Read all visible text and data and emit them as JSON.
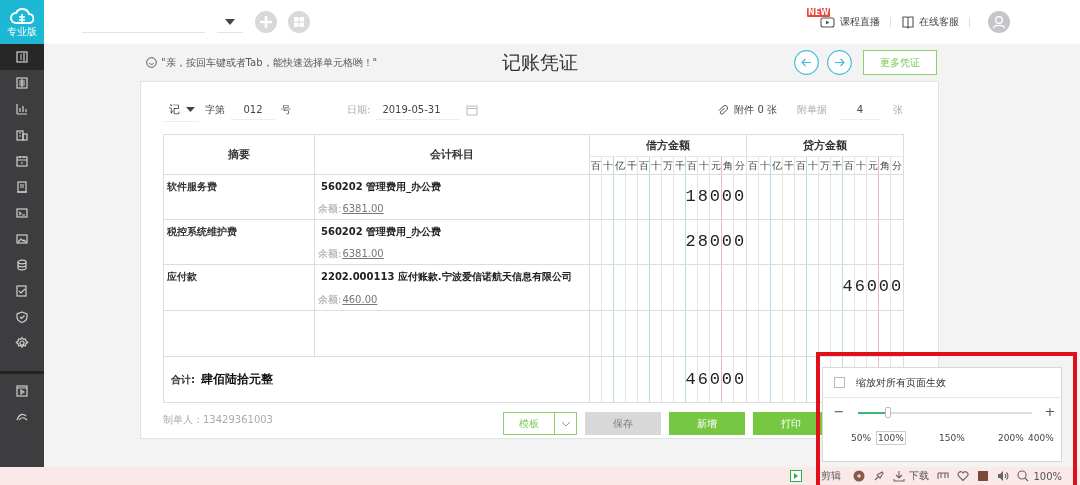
{
  "app": {
    "edition": "专业版"
  },
  "sidebar": {
    "items": [
      {
        "selected": true
      },
      {
        "selected": false
      },
      {
        "selected": false
      },
      {
        "selected": false
      },
      {
        "selected": false
      },
      {
        "selected": false
      },
      {
        "selected": false
      },
      {
        "selected": false
      },
      {
        "selected": false
      },
      {
        "selected": false
      },
      {
        "selected": false
      },
      {
        "selected": false
      }
    ],
    "extra_items": [
      {
        "selected": false
      },
      {
        "selected": false
      }
    ]
  },
  "topbar": {
    "new_badge": "NEW",
    "live_link": "课程直播",
    "service_link": "在线客服"
  },
  "voucher": {
    "tip": "\"亲，按回车键或者Tab，能快速选择单元格哟！\"",
    "title": "记账凭证",
    "more_button": "更多凭证",
    "type": "记",
    "word_label": "字第",
    "number": "012",
    "number_suffix": "号",
    "date_label": "日期:",
    "date": "2019-05-31",
    "attachments": "附件 0 张",
    "docs_label": "附单据",
    "docs_count": "4",
    "docs_suffix": "张",
    "table": {
      "columns": [
        "摘要",
        "会计科目",
        "借方金额",
        "贷方金额"
      ],
      "debit_units": [
        "百",
        "十",
        "亿",
        "千",
        "百",
        "十",
        "万",
        "千",
        "百",
        "十",
        "元",
        "角",
        "分"
      ],
      "credit_units": [
        "百",
        "十",
        "亿",
        "千",
        "百",
        "十",
        "万",
        "千",
        "百",
        "十",
        "元",
        "角",
        "分"
      ],
      "rows": [
        {
          "summary": "软件服务费",
          "account": "560202 管理费用_办公费",
          "balance_label": "余额:",
          "balance": "6381.00",
          "debit": "18000"
        },
        {
          "summary": "税控系统维护费",
          "account": "560202 管理费用_办公费",
          "balance_label": "余额:",
          "balance": "6381.00",
          "debit": "28000"
        },
        {
          "summary": "应付款",
          "account": "2202.000113 应付账款.宁波爱信诺航天信息有限公司",
          "balance_label": "余额:",
          "balance": "460.00",
          "credit": "46000"
        },
        {}
      ],
      "total_label": "合计:",
      "total_words": "肆佰陆拾元整",
      "total_debit": "46000"
    },
    "maker": "制单人：13429361003",
    "buttons": [
      {
        "kind": "split",
        "label": "模板",
        "disabled": false
      },
      {
        "kind": "solid",
        "label": "保存",
        "disabled": true
      },
      {
        "kind": "solid",
        "label": "新增",
        "disabled": false
      },
      {
        "kind": "solid",
        "label": "打印",
        "disabled": false
      }
    ]
  },
  "zoom_popup": {
    "checkbox": {
      "label": "缩放对所有页面生效",
      "checked": false
    },
    "minus": "−",
    "plus": "+",
    "slider": {
      "level": 0.17
    },
    "ticks": [
      {
        "label": "50%",
        "selected": false
      },
      {
        "label": "100%",
        "selected": true
      },
      {
        "label": "150%",
        "selected": false
      },
      {
        "label": "200%",
        "selected": false
      },
      {
        "label": "400%",
        "selected": false
      }
    ]
  },
  "status_bar": {
    "clip_label": "剪辑",
    "download_label": "下载",
    "zoom_label": "100%"
  }
}
